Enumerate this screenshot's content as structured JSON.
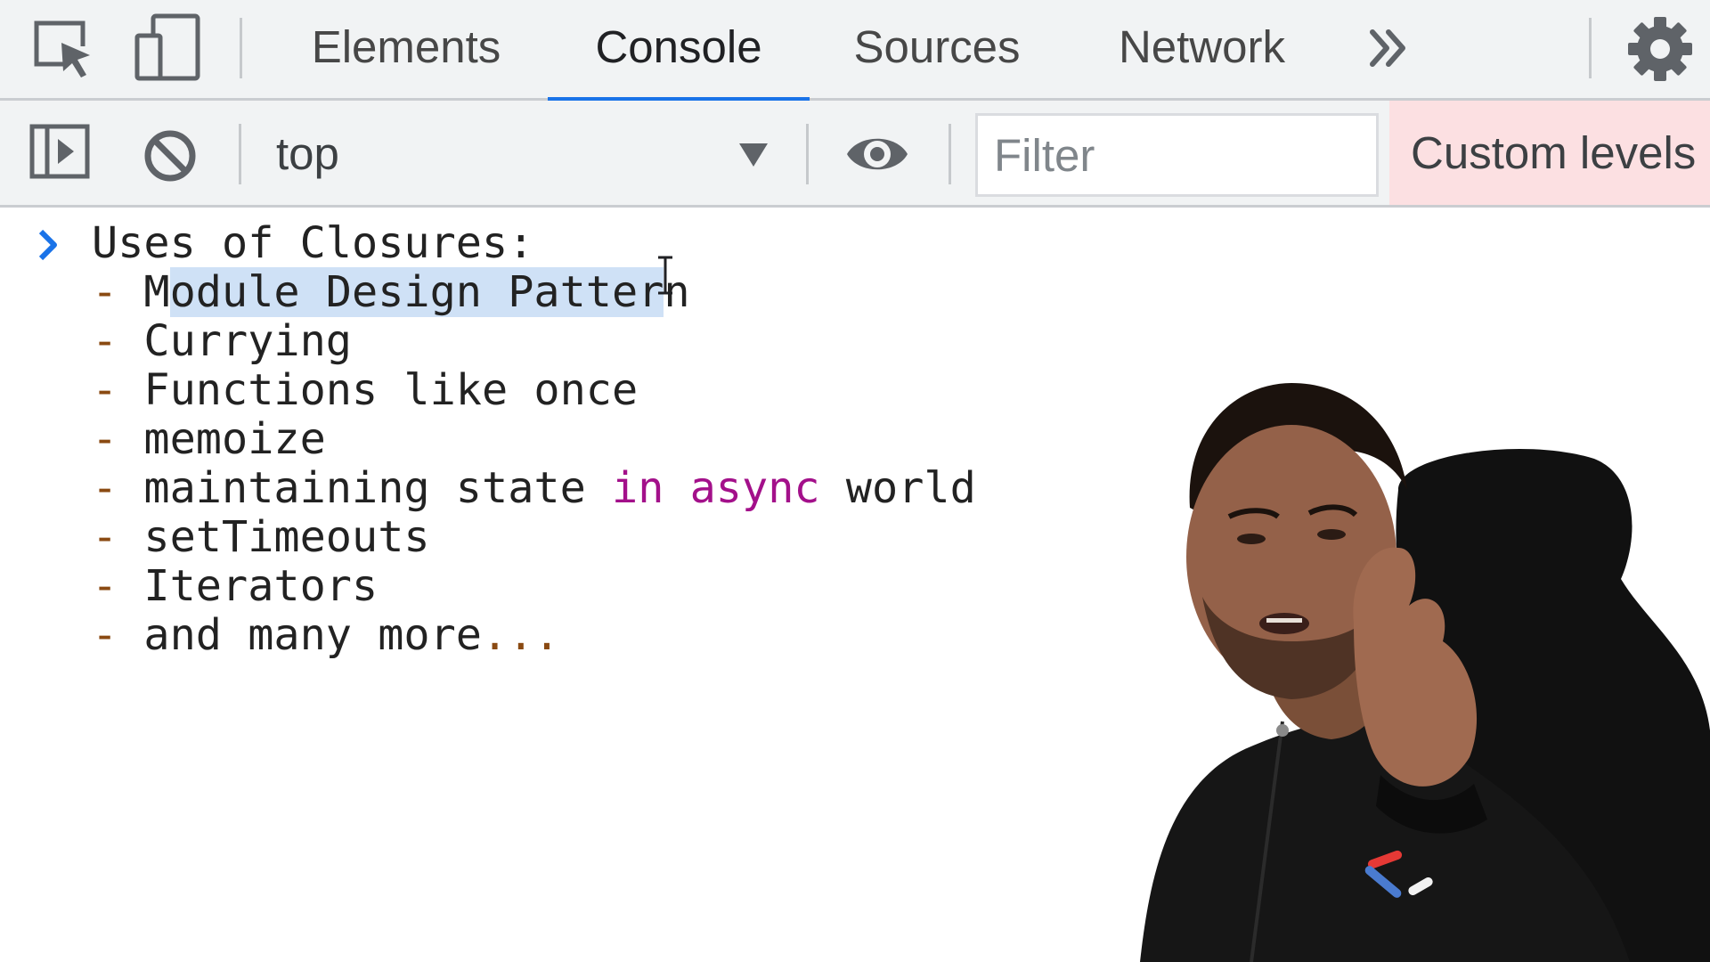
{
  "tabbar": {
    "tabs": [
      {
        "label": "Elements",
        "active": false
      },
      {
        "label": "Console",
        "active": true
      },
      {
        "label": "Sources",
        "active": false
      },
      {
        "label": "Network",
        "active": false
      }
    ],
    "more_tabs_icon": "double-chevron-right-icon",
    "settings_icon": "gear-icon",
    "active_color": "#1a73e8"
  },
  "toolbar": {
    "context": "top",
    "filter_placeholder": "Filter",
    "filter_value": "",
    "levels_label": "Custom levels",
    "levels_bg": "#fce0e2"
  },
  "console": {
    "header": "Uses of Closures:",
    "items": [
      {
        "dash": "-",
        "text": "Module Design Pattern",
        "selected_text": "odule Design Patter"
      },
      {
        "dash": "-",
        "text": "Currying"
      },
      {
        "dash": "-",
        "text": "Functions like once"
      },
      {
        "dash": "-",
        "text": "memoize"
      },
      {
        "dash": "-",
        "text_before": "maintaining state ",
        "keyword": "in async",
        "text_after": " world"
      },
      {
        "dash": "-",
        "text": "setTimeouts"
      },
      {
        "dash": "-",
        "text": "Iterators"
      },
      {
        "dash": "-",
        "text": "and many more",
        "dots": "..."
      }
    ]
  },
  "colors": {
    "keyword": "#a3108a",
    "dash": "#8a4a12",
    "selection": "#cfe1f6",
    "prompt": "#1a73e8"
  }
}
